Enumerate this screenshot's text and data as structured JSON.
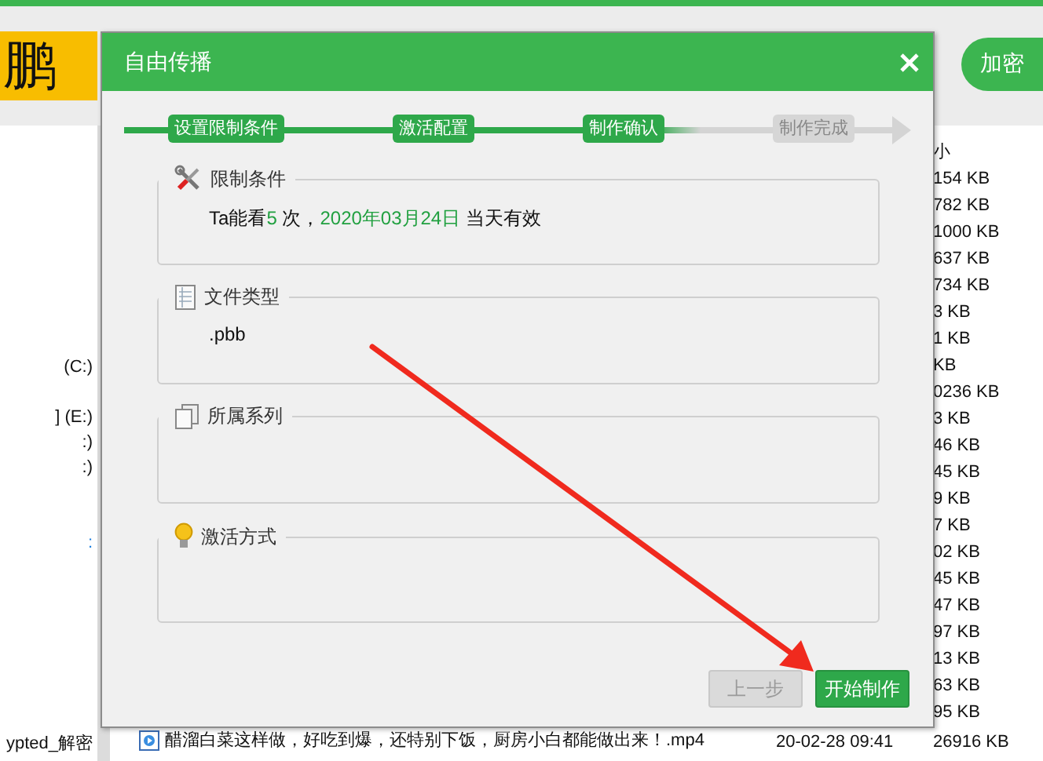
{
  "app": {
    "logo_text": "鹏",
    "action_button": "加密"
  },
  "left_panel": {
    "items": [
      {
        "label": "(C:)",
        "link": false
      },
      {
        "label": "] (E:)",
        "link": false
      },
      {
        "label": ":)",
        "link": false
      },
      {
        "label": ":)",
        "link": false
      },
      {
        "label": ":",
        "link": true
      },
      {
        "label": "ypted_解密",
        "link": false
      }
    ]
  },
  "file_list": {
    "size_header": "小",
    "sizes": [
      "154 KB",
      "782 KB",
      "1000 KB",
      "637 KB",
      "734 KB",
      "3 KB",
      "1 KB",
      "KB",
      "0236 KB",
      "3 KB",
      "46 KB",
      "45 KB",
      "9 KB",
      "7 KB",
      "02 KB",
      "45 KB",
      "47 KB",
      "97 KB",
      "13 KB",
      "63 KB",
      "95 KB"
    ],
    "file_row": {
      "name": "醋溜白菜这样做，好吃到爆，还特别下饭，厨房小白都能做出来！.mp4",
      "modified": "20-02-28 09:41",
      "size": "26916 KB"
    }
  },
  "dialog": {
    "title": "自由传播",
    "steps": [
      {
        "label": "设置限制条件",
        "completed": true
      },
      {
        "label": "激活配置",
        "completed": true
      },
      {
        "label": "制作确认",
        "completed": true
      },
      {
        "label": "制作完成",
        "completed": false
      }
    ],
    "sections": [
      {
        "kind": "limits",
        "title": "限制条件",
        "content": [
          {
            "text": "Ta能看",
            "highlight": false
          },
          {
            "text": "5",
            "highlight": true
          },
          {
            "text": " 次，",
            "highlight": false
          },
          {
            "text": "2020年03月24日",
            "highlight": true
          },
          {
            "text": " 当天有效",
            "highlight": false
          }
        ]
      },
      {
        "kind": "file_type",
        "title": "文件类型",
        "content": [
          {
            "text": ".pbb",
            "highlight": false
          }
        ]
      },
      {
        "kind": "series",
        "title": "所属系列"
      },
      {
        "kind": "activation",
        "title": "激活方式"
      }
    ],
    "buttons": [
      {
        "label": "上一步",
        "disabled": true
      },
      {
        "label": "开始制作",
        "disabled": false
      }
    ]
  }
}
